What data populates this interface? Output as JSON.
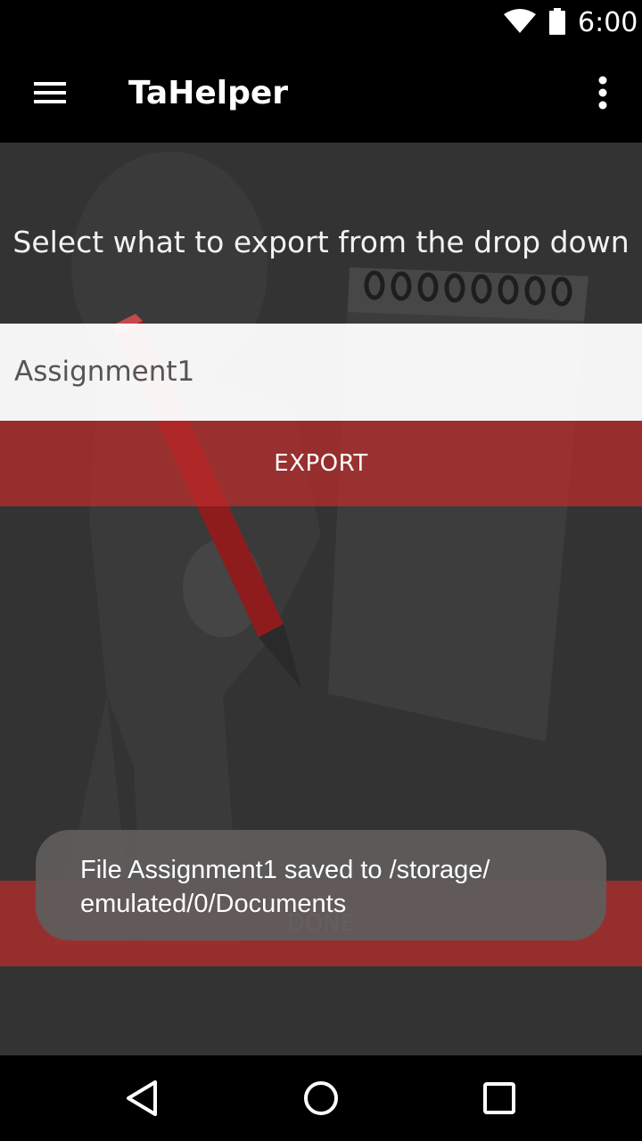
{
  "status_bar": {
    "time": "6:00",
    "icons": [
      "wifi-icon",
      "battery-icon"
    ]
  },
  "app_bar": {
    "title": "TaHelper",
    "menu_icon": "hamburger-menu-icon",
    "overflow_icon": "more-vert-icon"
  },
  "main": {
    "instruction": "Select what to export from the drop down",
    "dropdown": {
      "selected": "Assignment1"
    },
    "export_label": "EXPORT",
    "done_label": "DONE"
  },
  "toast": {
    "line1": "File Assignment1 saved to /storage/",
    "line2": "emulated/0/Documents"
  },
  "nav_bar": {
    "icons": [
      "back-icon",
      "home-icon",
      "recents-icon"
    ]
  },
  "colors": {
    "accent": "#be2d2d",
    "background": "#333333",
    "toast": "#5f5c5c"
  }
}
